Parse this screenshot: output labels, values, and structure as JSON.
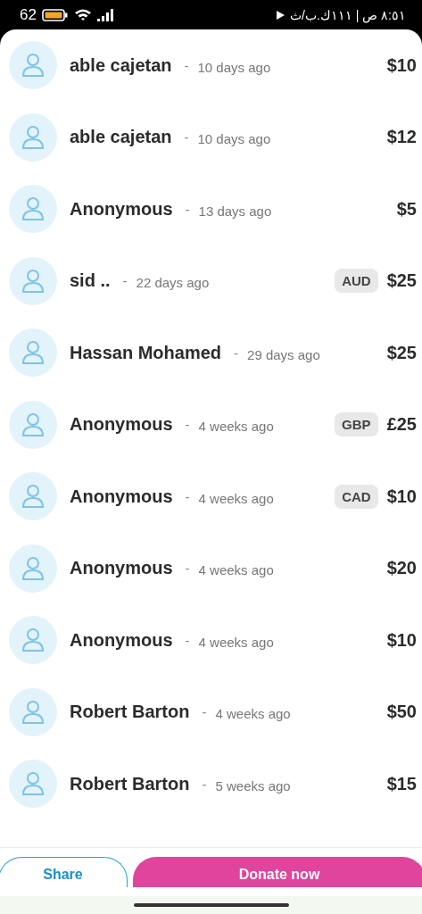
{
  "status_bar": {
    "battery": "62",
    "clock": "٨:٥١ ص | ١١١ك.ب/ث"
  },
  "donations": [
    {
      "name": "able cajetan",
      "separator": "-",
      "time": "10 days ago",
      "amount": "$10"
    },
    {
      "name": "able cajetan",
      "separator": "-",
      "time": "10 days ago",
      "amount": "$12"
    },
    {
      "name": "Anonymous",
      "separator": "-",
      "time": "13 days ago",
      "amount": "$5"
    },
    {
      "name": "sid ..",
      "separator": "-",
      "time": "22 days ago",
      "currency": "AUD",
      "amount": "$25"
    },
    {
      "name": "Hassan Mohamed",
      "separator": "-",
      "time": "29 days ago",
      "amount": "$25"
    },
    {
      "name": "Anonymous",
      "separator": "-",
      "time": "4 weeks ago",
      "currency": "GBP",
      "amount": "£25"
    },
    {
      "name": "Anonymous",
      "separator": "-",
      "time": "4 weeks ago",
      "currency": "CAD",
      "amount": "$10"
    },
    {
      "name": "Anonymous",
      "separator": "-",
      "time": "4 weeks ago",
      "amount": "$20"
    },
    {
      "name": "Anonymous",
      "separator": "-",
      "time": "4 weeks ago",
      "amount": "$10"
    },
    {
      "name": "Robert Barton",
      "separator": "-",
      "time": "4 weeks ago",
      "amount": "$50"
    },
    {
      "name": "Robert Barton",
      "separator": "-",
      "time": "5 weeks ago",
      "amount": "$15"
    }
  ],
  "buttons": {
    "share": "Share",
    "donate": "Donate now"
  }
}
